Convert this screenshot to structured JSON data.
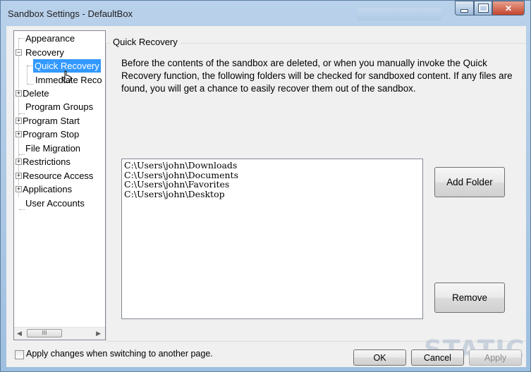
{
  "window": {
    "title": "Sandbox Settings - DefaultBox",
    "controls": {
      "minimize_icon": "minimize-icon",
      "maximize_icon": "maximize-icon",
      "close_icon": "close-icon",
      "close_glyph": "✕"
    },
    "accent_color": "#3399ff"
  },
  "tree": {
    "expand_glyph": "+",
    "collapse_glyph": "−",
    "items": [
      {
        "label": "Appearance"
      },
      {
        "label": "Recovery"
      },
      {
        "label": "Quick Recovery",
        "selected": true
      },
      {
        "label": "Immediate Reco"
      },
      {
        "label": "Delete"
      },
      {
        "label": "Program Groups"
      },
      {
        "label": "Program Start"
      },
      {
        "label": "Program Stop"
      },
      {
        "label": "File Migration"
      },
      {
        "label": "Restrictions"
      },
      {
        "label": "Resource Access"
      },
      {
        "label": "Applications"
      },
      {
        "label": "User Accounts"
      }
    ],
    "scrollbar": {
      "left_arrow": "◀",
      "right_arrow": "▶",
      "thumb_grip": "III"
    }
  },
  "panel": {
    "title": "Quick Recovery",
    "description": "Before the contents of the sandbox are deleted, or when you manually invoke the Quick Recovery function, the following folders will be checked for sandboxed content.  If any files are found, you will get a chance to easily recover them out of the sandbox.",
    "folders": [
      "C:\\Users\\john\\Downloads",
      "C:\\Users\\john\\Documents",
      "C:\\Users\\john\\Favorites",
      "C:\\Users\\john\\Desktop"
    ],
    "add_folder_label": "Add Folder",
    "remove_label": "Remove"
  },
  "footer": {
    "apply_on_switch_label": "Apply changes when switching to another page.",
    "apply_on_switch_checked": false,
    "ok_label": "OK",
    "cancel_label": "Cancel",
    "apply_label": "Apply"
  },
  "watermark": "STATIC"
}
